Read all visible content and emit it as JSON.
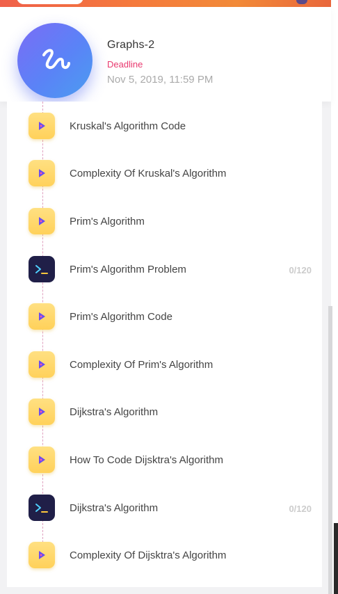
{
  "course": {
    "title": "Graphs-2",
    "deadline_label": "Deadline",
    "deadline_date": "Nov 5, 2019, 11:59 PM",
    "logo_icon": "script-logo-icon"
  },
  "colors": {
    "deadline": "#e9396f",
    "video_icon_bg": "#ffd15a",
    "problem_icon_bg": "#201f48",
    "accent_purple": "#6a4cf0"
  },
  "items": [
    {
      "type": "video",
      "icon": "play-icon",
      "title": "Kruskal's Algorithm Code"
    },
    {
      "type": "video",
      "icon": "play-icon",
      "title": "Complexity Of Kruskal's Algorithm"
    },
    {
      "type": "video",
      "icon": "play-icon",
      "title": "Prim's Algorithm"
    },
    {
      "type": "problem",
      "icon": "terminal-icon",
      "title": "Prim's Algorithm Problem",
      "score": "0/120"
    },
    {
      "type": "video",
      "icon": "play-icon",
      "title": "Prim's Algorithm Code"
    },
    {
      "type": "video",
      "icon": "play-icon",
      "title": "Complexity Of Prim's Algorithm"
    },
    {
      "type": "video",
      "icon": "play-icon",
      "title": "Dijkstra's Algorithm"
    },
    {
      "type": "video",
      "icon": "play-icon",
      "title": "How To Code Dijsktra's Algorithm"
    },
    {
      "type": "problem",
      "icon": "terminal-icon",
      "title": "Dijkstra's Algorithm",
      "score": "0/120"
    },
    {
      "type": "video",
      "icon": "play-icon",
      "title": "Complexity Of Dijsktra's Algorithm"
    }
  ]
}
